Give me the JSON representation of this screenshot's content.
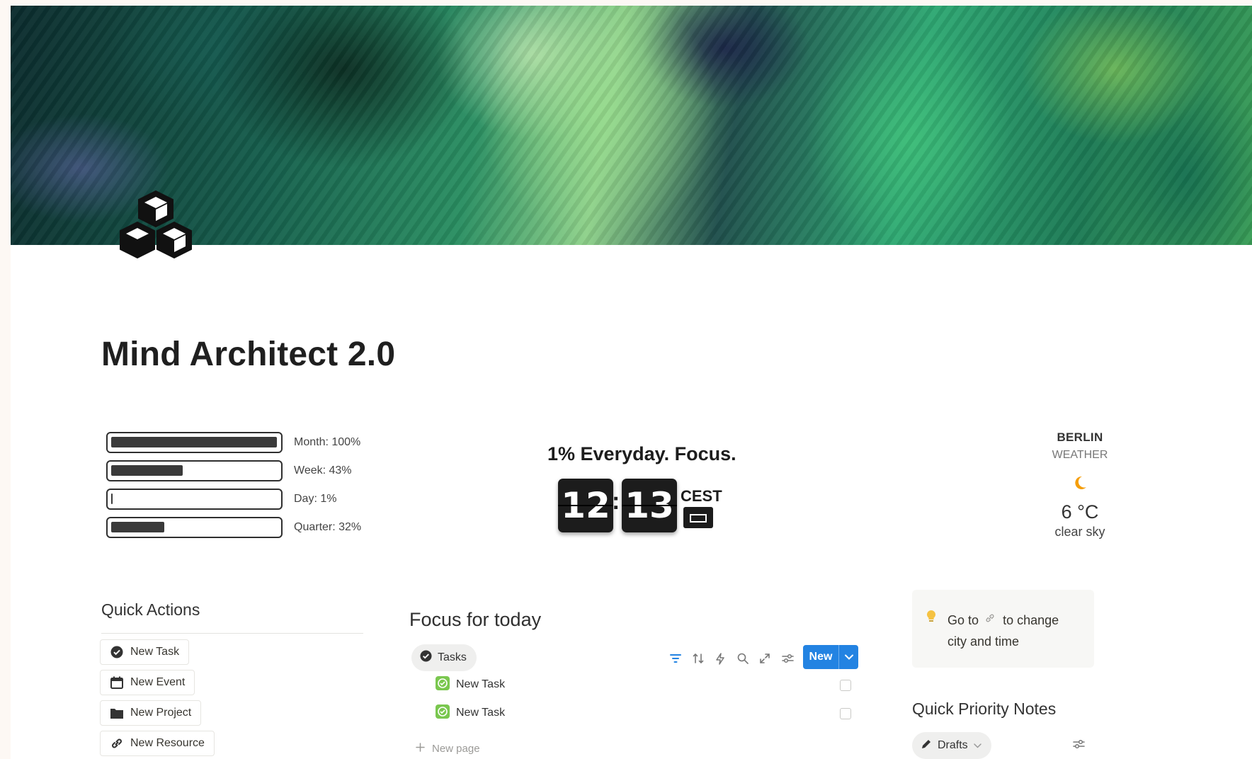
{
  "page": {
    "title": "Mind Architect 2.0"
  },
  "progress": [
    {
      "label": "Month: 100%",
      "fill": 1.0
    },
    {
      "label": "Week: 43%",
      "fill": 0.43
    },
    {
      "label": "Day: 1%",
      "fill": 0.01
    },
    {
      "label": "Quarter: 32%",
      "fill": 0.32
    }
  ],
  "clock": {
    "motto": "1% Everyday. Focus.",
    "hours": "12",
    "minutes": "13",
    "separator": ":",
    "timezone": "CEST"
  },
  "weather": {
    "city": "BERLIN",
    "subtitle": "WEATHER",
    "temperature": "6 °C",
    "description": "clear sky",
    "icon": "moon-icon",
    "icon_color": "#f59e0b"
  },
  "quick_actions": {
    "title": "Quick Actions",
    "buttons": [
      {
        "label": "New Task",
        "icon": "check-circle-icon"
      },
      {
        "label": "New Event",
        "icon": "calendar-icon"
      },
      {
        "label": "New Project",
        "icon": "folder-icon"
      },
      {
        "label": "New Resource",
        "icon": "link-icon"
      }
    ]
  },
  "focus": {
    "title": "Focus for today",
    "tab_label": "Tasks",
    "toolbar_icons": [
      "filter-icon",
      "sort-icon",
      "lightning-icon",
      "search-icon",
      "expand-icon",
      "settings-icon"
    ],
    "new_button": "New",
    "tasks": [
      {
        "label": "New Task",
        "checked": false
      },
      {
        "label": "New Task",
        "checked": false
      }
    ],
    "new_page": "New page",
    "accent": "#2383e2"
  },
  "callout": {
    "line1_prefix": "Go to",
    "line1_suffix": "to change",
    "line2": "city and time"
  },
  "priority_notes": {
    "title": "Quick Priority Notes",
    "tab_label": "Drafts"
  }
}
